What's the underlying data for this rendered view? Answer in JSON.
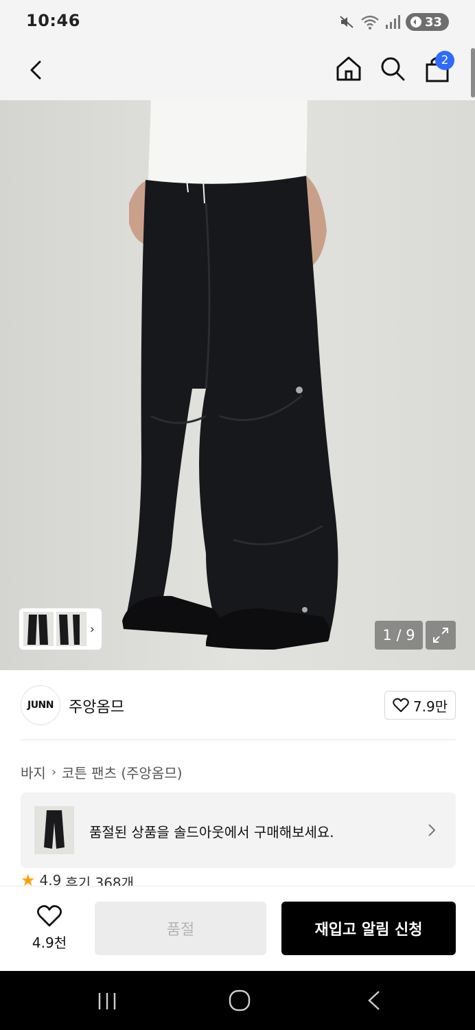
{
  "status_bar": {
    "time": "10:46",
    "battery": "33",
    "icons": [
      "mute-icon",
      "wifi-icon",
      "signal-icon",
      "battery-icon"
    ]
  },
  "nav": {
    "cart_count": "2",
    "icons": [
      "back-icon",
      "home-icon",
      "search-icon",
      "cart-icon"
    ]
  },
  "gallery": {
    "page_indicator": "1 / 9",
    "current_page": 1,
    "total_pages": 9
  },
  "brand": {
    "logo_text": "JUNN",
    "name": "주앙옴므",
    "likes": "7.9만"
  },
  "breadcrumb": {
    "category": "바지",
    "subcategory": "코튼 팬츠 (주앙옴므)"
  },
  "soldout_banner": {
    "text": "품절된 상품을 솔드아웃에서 구매해보세요."
  },
  "rating": {
    "score": "4.9",
    "reviews": "후기 368개"
  },
  "actions": {
    "wish_count": "4.9천",
    "soldout_label": "품절",
    "restock_label": "재입고 알림 신청"
  },
  "colors": {
    "accent_blue": "#2f6bff",
    "star": "#ff9f00",
    "primary_button": "#000000",
    "disabled_button": "#ececec"
  }
}
